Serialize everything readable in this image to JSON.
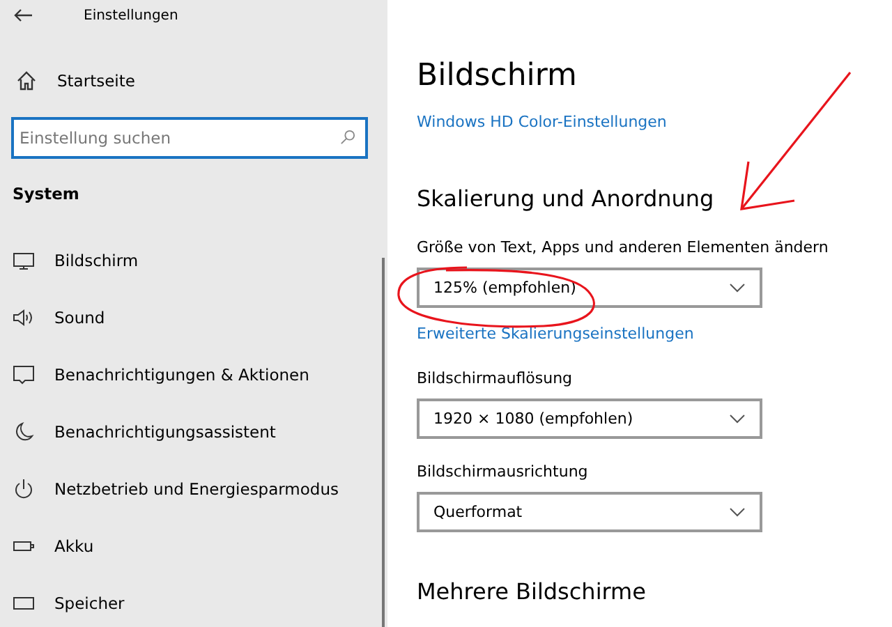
{
  "window": {
    "title": "Einstellungen"
  },
  "sidebar": {
    "home": "Startseite",
    "search": {
      "placeholder": "Einstellung suchen"
    },
    "section": "System",
    "items": [
      {
        "label": "Bildschirm"
      },
      {
        "label": "Sound"
      },
      {
        "label": "Benachrichtigungen & Aktionen"
      },
      {
        "label": "Benachrichtigungsassistent"
      },
      {
        "label": "Netzbetrieb und Energiesparmodus"
      },
      {
        "label": "Akku"
      },
      {
        "label": "Speicher"
      }
    ]
  },
  "main": {
    "title": "Bildschirm",
    "hd_link": "Windows HD Color-Einstellungen",
    "section": "Skalierung und Anordnung",
    "scale": {
      "label": "Größe von Text, Apps und anderen Elementen ändern",
      "value": "125% (empfohlen)"
    },
    "scale_link": "Erweiterte Skalierungseinstellungen",
    "resolution": {
      "label": "Bildschirmauflösung",
      "value": "1920 × 1080 (empfohlen)"
    },
    "orientation": {
      "label": "Bildschirmausrichtung",
      "value": "Querformat"
    },
    "section2": "Mehrere Bildschirme"
  }
}
